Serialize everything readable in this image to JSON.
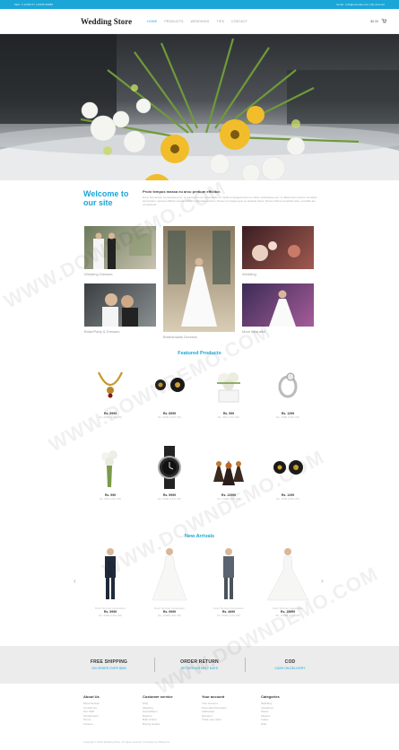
{
  "topbar": {
    "left": "Mail : 0 12345 67 | 02345 56989",
    "right": "Email : info@example.com | My account"
  },
  "header": {
    "logo": "Wedding Store",
    "nav": [
      "HOME",
      "PRODUCTS",
      "WEDDINGS",
      "TIPS",
      "CONTACT"
    ],
    "cart": "$0.00",
    "cart_icon": "cart-icon"
  },
  "welcome": {
    "title": "Welcome to our site",
    "subtitle": "Proin tempus massa eu arcu pretium efficitur.",
    "body": "Nunc fermentum consequat enim, ut euismod nunc consectetur at. Nulla consequat ipsum ut dolor scelerisque nec. In ullamcorper ipsum vel tellus elementum, semper efficitur massa. Nullam vulputate pretium. Donec vel augue quis ex pulvinar lacus. Donec finibus imperdiet ante, convallis leo consectetur."
  },
  "gallery": [
    {
      "caption": "Wedding Dresses"
    },
    {
      "caption": "Bridesmaids Dresses"
    },
    {
      "caption": "Wedding"
    },
    {
      "caption": "Bride/Party & Dresses"
    },
    {
      "caption": "More Beautiful"
    }
  ],
  "featured": {
    "title": "Featured Products",
    "items": [
      {
        "price": "Rs. 5999",
        "old": "Rs. 6999 (16% Off)"
      },
      {
        "price": "Rs. 8999",
        "old": "Rs. 9999 (10% Off)"
      },
      {
        "price": "Rs. 599",
        "old": "Rs. 699 (14% Off)"
      },
      {
        "price": "Rs. 1299",
        "old": "Rs. 1599 (18% Off)"
      },
      {
        "price": "Rs. 599",
        "old": "Rs. 699 (14% Off)"
      },
      {
        "price": "Rs. 5999",
        "old": "Rs. 6999 (16% Off)"
      },
      {
        "price": "Rs. 12999",
        "old": "Rs. 13999 (7% Off)"
      },
      {
        "price": "Rs. 1299",
        "old": "Rs. 1599 (18% Off)"
      }
    ]
  },
  "arrivals": {
    "title": "New Arrivals",
    "items": [
      {
        "name": "Dolor Sit Amet Consectetur",
        "price": "Rs. 5999",
        "old": "Rs. 6999 (16% Off)"
      },
      {
        "name": "Dolor Sit Amet Consectetur",
        "price": "Rs. 9999",
        "old": "Rs. 10999 (9% Off)"
      },
      {
        "name": "Dolor Sit Amet Consectetur",
        "price": "Rs. 4699",
        "old": "Rs. 5699 (17% Off)"
      },
      {
        "name": "Dolor Sit Amet Consectetur",
        "price": "Rs. 15999",
        "old": "Rs. 17999 (11% Off)"
      }
    ],
    "prev": "‹",
    "next": "›"
  },
  "services": [
    {
      "title": "FREE SHIPPING",
      "sub": "ON ORDER OVER $500"
    },
    {
      "title": "ORDER RETURN",
      "sub": "RETURN WITHIN 7 DAYS"
    },
    {
      "title": "COD",
      "sub": "CASH ON DELIVERY"
    }
  ],
  "footer": {
    "columns": [
      {
        "title": "About Us",
        "items": [
          "Mens Section",
          "Contact Us",
          "Our Staff",
          "Sit Members",
          "Terms",
          "Careers"
        ]
      },
      {
        "title": "Customer service",
        "items": [
          "FAQ",
          "Shipping",
          "Cancellation",
          "Returns",
          "Bulk Orders",
          "Buying Guides"
        ]
      },
      {
        "title": "Your account",
        "items": [
          "Your Account",
          "Personal Information",
          "Addresses",
          "Discount",
          "Track your order"
        ]
      },
      {
        "title": "Categories",
        "items": [
          "Wedding",
          "Jewellerys",
          "Shoes",
          "Flowers",
          "Cakes",
          "Gifts"
        ]
      }
    ],
    "copyright": "Copyright © 2016 Wedding Store. All rights reserved | Template by W3layouts"
  },
  "watermark": "WWW.DOWNDEMO.COM",
  "colors": {
    "accent": "#1ba6d8",
    "service_bg": "#ececec"
  }
}
